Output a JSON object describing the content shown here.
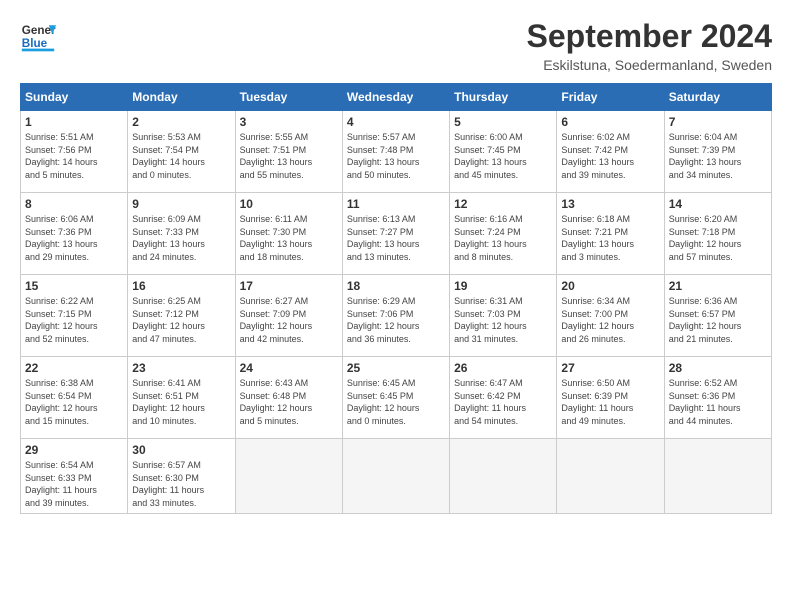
{
  "header": {
    "logo_general": "General",
    "logo_blue": "Blue",
    "main_title": "September 2024",
    "subtitle": "Eskilstuna, Soedermanland, Sweden"
  },
  "days_of_week": [
    "Sunday",
    "Monday",
    "Tuesday",
    "Wednesday",
    "Thursday",
    "Friday",
    "Saturday"
  ],
  "weeks": [
    [
      {
        "day": "1",
        "info": "Sunrise: 5:51 AM\nSunset: 7:56 PM\nDaylight: 14 hours\nand 5 minutes."
      },
      {
        "day": "2",
        "info": "Sunrise: 5:53 AM\nSunset: 7:54 PM\nDaylight: 14 hours\nand 0 minutes."
      },
      {
        "day": "3",
        "info": "Sunrise: 5:55 AM\nSunset: 7:51 PM\nDaylight: 13 hours\nand 55 minutes."
      },
      {
        "day": "4",
        "info": "Sunrise: 5:57 AM\nSunset: 7:48 PM\nDaylight: 13 hours\nand 50 minutes."
      },
      {
        "day": "5",
        "info": "Sunrise: 6:00 AM\nSunset: 7:45 PM\nDaylight: 13 hours\nand 45 minutes."
      },
      {
        "day": "6",
        "info": "Sunrise: 6:02 AM\nSunset: 7:42 PM\nDaylight: 13 hours\nand 39 minutes."
      },
      {
        "day": "7",
        "info": "Sunrise: 6:04 AM\nSunset: 7:39 PM\nDaylight: 13 hours\nand 34 minutes."
      }
    ],
    [
      {
        "day": "8",
        "info": "Sunrise: 6:06 AM\nSunset: 7:36 PM\nDaylight: 13 hours\nand 29 minutes."
      },
      {
        "day": "9",
        "info": "Sunrise: 6:09 AM\nSunset: 7:33 PM\nDaylight: 13 hours\nand 24 minutes."
      },
      {
        "day": "10",
        "info": "Sunrise: 6:11 AM\nSunset: 7:30 PM\nDaylight: 13 hours\nand 18 minutes."
      },
      {
        "day": "11",
        "info": "Sunrise: 6:13 AM\nSunset: 7:27 PM\nDaylight: 13 hours\nand 13 minutes."
      },
      {
        "day": "12",
        "info": "Sunrise: 6:16 AM\nSunset: 7:24 PM\nDaylight: 13 hours\nand 8 minutes."
      },
      {
        "day": "13",
        "info": "Sunrise: 6:18 AM\nSunset: 7:21 PM\nDaylight: 13 hours\nand 3 minutes."
      },
      {
        "day": "14",
        "info": "Sunrise: 6:20 AM\nSunset: 7:18 PM\nDaylight: 12 hours\nand 57 minutes."
      }
    ],
    [
      {
        "day": "15",
        "info": "Sunrise: 6:22 AM\nSunset: 7:15 PM\nDaylight: 12 hours\nand 52 minutes."
      },
      {
        "day": "16",
        "info": "Sunrise: 6:25 AM\nSunset: 7:12 PM\nDaylight: 12 hours\nand 47 minutes."
      },
      {
        "day": "17",
        "info": "Sunrise: 6:27 AM\nSunset: 7:09 PM\nDaylight: 12 hours\nand 42 minutes."
      },
      {
        "day": "18",
        "info": "Sunrise: 6:29 AM\nSunset: 7:06 PM\nDaylight: 12 hours\nand 36 minutes."
      },
      {
        "day": "19",
        "info": "Sunrise: 6:31 AM\nSunset: 7:03 PM\nDaylight: 12 hours\nand 31 minutes."
      },
      {
        "day": "20",
        "info": "Sunrise: 6:34 AM\nSunset: 7:00 PM\nDaylight: 12 hours\nand 26 minutes."
      },
      {
        "day": "21",
        "info": "Sunrise: 6:36 AM\nSunset: 6:57 PM\nDaylight: 12 hours\nand 21 minutes."
      }
    ],
    [
      {
        "day": "22",
        "info": "Sunrise: 6:38 AM\nSunset: 6:54 PM\nDaylight: 12 hours\nand 15 minutes."
      },
      {
        "day": "23",
        "info": "Sunrise: 6:41 AM\nSunset: 6:51 PM\nDaylight: 12 hours\nand 10 minutes."
      },
      {
        "day": "24",
        "info": "Sunrise: 6:43 AM\nSunset: 6:48 PM\nDaylight: 12 hours\nand 5 minutes."
      },
      {
        "day": "25",
        "info": "Sunrise: 6:45 AM\nSunset: 6:45 PM\nDaylight: 12 hours\nand 0 minutes."
      },
      {
        "day": "26",
        "info": "Sunrise: 6:47 AM\nSunset: 6:42 PM\nDaylight: 11 hours\nand 54 minutes."
      },
      {
        "day": "27",
        "info": "Sunrise: 6:50 AM\nSunset: 6:39 PM\nDaylight: 11 hours\nand 49 minutes."
      },
      {
        "day": "28",
        "info": "Sunrise: 6:52 AM\nSunset: 6:36 PM\nDaylight: 11 hours\nand 44 minutes."
      }
    ],
    [
      {
        "day": "29",
        "info": "Sunrise: 6:54 AM\nSunset: 6:33 PM\nDaylight: 11 hours\nand 39 minutes."
      },
      {
        "day": "30",
        "info": "Sunrise: 6:57 AM\nSunset: 6:30 PM\nDaylight: 11 hours\nand 33 minutes."
      },
      {
        "day": "",
        "info": ""
      },
      {
        "day": "",
        "info": ""
      },
      {
        "day": "",
        "info": ""
      },
      {
        "day": "",
        "info": ""
      },
      {
        "day": "",
        "info": ""
      }
    ]
  ]
}
